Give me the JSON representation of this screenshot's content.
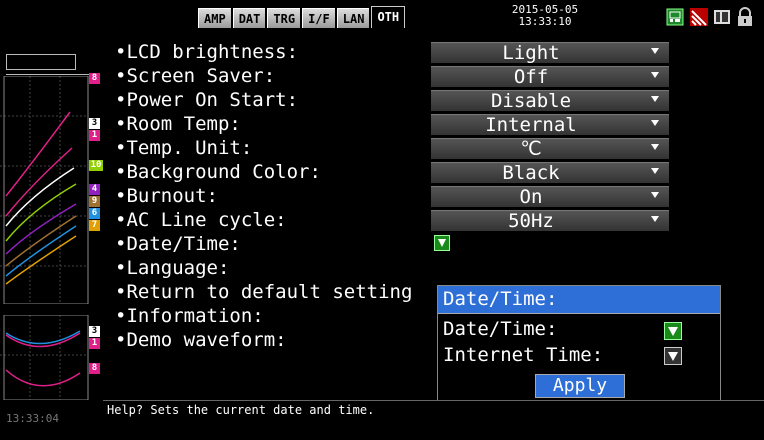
{
  "tabs": [
    {
      "label": "AMP",
      "active": false
    },
    {
      "label": "DAT",
      "active": false
    },
    {
      "label": "TRG",
      "active": false
    },
    {
      "label": "I/F",
      "active": false
    },
    {
      "label": "LAN",
      "active": false
    },
    {
      "label": "OTH",
      "active": true
    }
  ],
  "datetime": {
    "date": "2015-05-05",
    "time": "13:33:10"
  },
  "status_icons": [
    "memory-card-icon",
    "network-signal-icon",
    "battery-icon",
    "lock-icon"
  ],
  "settings": [
    {
      "label": "•LCD brightness:",
      "value": "Light",
      "type": "select"
    },
    {
      "label": "•Screen Saver:",
      "value": "Off",
      "type": "select"
    },
    {
      "label": "•Power On Start:",
      "value": "Disable",
      "type": "select"
    },
    {
      "label": "•Room Temp:",
      "value": "Internal",
      "type": "select"
    },
    {
      "label": "•Temp. Unit:",
      "value": "℃",
      "type": "select"
    },
    {
      "label": "•Background Color:",
      "value": "Black",
      "type": "select"
    },
    {
      "label": "•Burnout:",
      "value": "On",
      "type": "select"
    },
    {
      "label": "•AC Line cycle:",
      "value": "50Hz",
      "type": "select"
    },
    {
      "label": "•Date/Time:",
      "value": "",
      "type": "check"
    },
    {
      "label": "•Language:",
      "value": "",
      "type": "none"
    },
    {
      "label": "•Return to default setting",
      "value": "",
      "type": "none"
    },
    {
      "label": "•Information:",
      "value": "",
      "type": "none"
    },
    {
      "label": "•Demo waveform:",
      "value": "",
      "type": "none"
    }
  ],
  "popup": {
    "title": "Date/Time:",
    "rows": [
      {
        "label": "Date/Time:",
        "checked": true
      },
      {
        "label": "Internet Time:",
        "checked": false
      }
    ],
    "apply_label": "Apply"
  },
  "channels_top": [
    {
      "num": "8",
      "color": "#e0208a"
    },
    {
      "num": "3",
      "color": "#ffffff"
    },
    {
      "num": "1",
      "color": "#e0208a"
    },
    {
      "num": "10",
      "color": "#90d000"
    },
    {
      "num": "4",
      "color": "#9020c0"
    },
    {
      "num": "9",
      "color": "#a07030"
    },
    {
      "num": "6",
      "color": "#2090e0"
    },
    {
      "num": "7",
      "color": "#e0a000"
    }
  ],
  "channels_bottom": [
    {
      "num": "3",
      "color": "#ffffff"
    },
    {
      "num": "1",
      "color": "#e0208a"
    },
    {
      "num": "8",
      "color": "#e0208a"
    }
  ],
  "clock": "13:33:04",
  "help_text": "Help?  Sets the current date and time."
}
